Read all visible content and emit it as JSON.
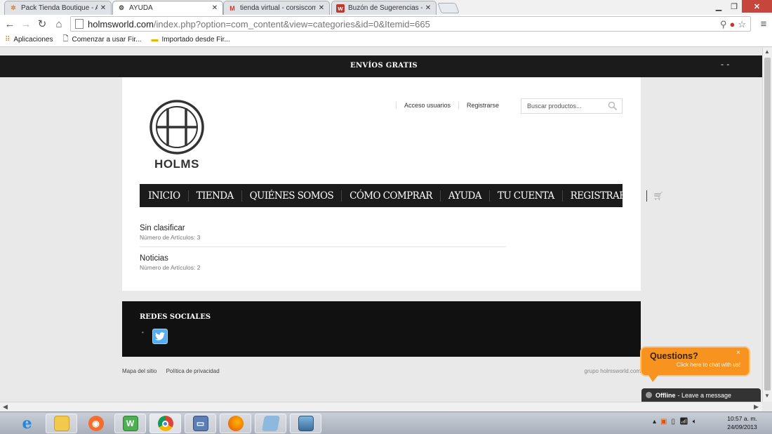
{
  "browser": {
    "tabs": [
      {
        "title": "Pack Tienda Boutique - A",
        "favicon": "joomla-icon",
        "active": false
      },
      {
        "title": "AYUDA",
        "favicon": "site-icon",
        "active": true
      },
      {
        "title": "tienda virtual - corsiscom",
        "favicon": "gmail-icon",
        "active": false
      },
      {
        "title": "Buzón de Sugerencias - Fo",
        "favicon": "w-icon",
        "active": false
      }
    ],
    "url_host": "holmsworld.com",
    "url_rest": "/index.php?option=com_content&view=categories&id=0&Itemid=665",
    "bookmarks": [
      {
        "label": "Aplicaciones",
        "icon": "apps-grid-icon"
      },
      {
        "label": "Comenzar a usar Fir...",
        "icon": "page-icon"
      },
      {
        "label": "Importado desde Fir...",
        "icon": "folder-icon"
      }
    ]
  },
  "site": {
    "topbar_text": "ENVÍOS GRATIS",
    "lang_text": "- -",
    "logo_text": "HOLMS",
    "user_links": [
      "Acceso usuarios",
      "Registrarse"
    ],
    "search_placeholder": "Buscar productos...",
    "menu": [
      "INICIO",
      "TIENDA",
      "QUIÉNES SOMOS",
      "CÓMO COMPRAR",
      "AYUDA",
      "TU CUENTA",
      "REGISTRARSE"
    ],
    "categories": [
      {
        "name": "Sin clasificar",
        "count_label": "Número de Artículos: 3"
      },
      {
        "name": "Noticias",
        "count_label": "Número de Artículos: 2"
      }
    ],
    "social_title": "REDES SOCIALES",
    "footer_links": [
      "Mapa del sitio",
      "Política de privacidad"
    ],
    "footer_right": "grupo holmsworld.com",
    "chat": {
      "title": "Questions?",
      "subtitle": "Click here to chat with us!",
      "close": "×",
      "offline_bold": "Offline",
      "offline_rest": "- Leave a message"
    }
  },
  "taskbar": {
    "clock_time": "10:57 a. m.",
    "clock_date": "24/09/2013"
  },
  "colors": {
    "dark_bar": "#1b1b1b",
    "chat_orange": "#f7931e",
    "twitter_blue": "#55acee",
    "close_red": "#c7463b"
  }
}
